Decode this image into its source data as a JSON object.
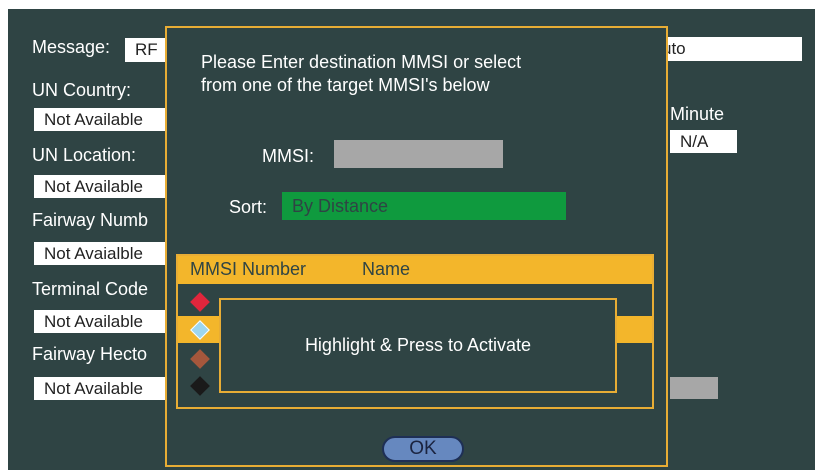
{
  "background_form": {
    "message_label": "Message:",
    "message_value": "RF",
    "message_right_value": "uto",
    "un_country_label": "UN Country:",
    "un_country_value": "Not Available",
    "minute_label": "Minute",
    "minute_value": "N/A",
    "un_location_label": "UN Location:",
    "un_location_value": "Not Available",
    "fairway_number_label": "Fairway Numb",
    "fairway_number_value": "Not Avaialble",
    "terminal_code_label": "Terminal Code",
    "terminal_code_value": "Not Available",
    "fairway_hecto_label": "Fairway Hecto",
    "fairway_hecto_value": "Not Available"
  },
  "dialog": {
    "prompt_line1": "Please Enter destination MMSI or select",
    "prompt_line2": "from one of the target MMSI's below",
    "mmsi_label": "MMSI:",
    "mmsi_value": "",
    "sort_label": "Sort:",
    "sort_value": "By Distance",
    "table_headers": [
      "MMSI Number",
      "Name"
    ],
    "rows": [
      {
        "icon": "red-diamond-icon",
        "color": "#e0263c"
      },
      {
        "icon": "light-blue-diamond-icon",
        "color": "#9dd6ef",
        "highlighted": true
      },
      {
        "icon": "brown-diamond-icon",
        "color": "#a5573c"
      },
      {
        "icon": "black-diamond-icon",
        "color": "#1a1a1a"
      }
    ],
    "hint_text": "Highlight & Press to Activate",
    "ok_label": "OK"
  },
  "colors": {
    "background": "#2f4444",
    "accent_border": "#e8ad35",
    "table_header": "#f3b62b",
    "sort_field": "#0f9a3e",
    "ok_button": "#6688bf"
  }
}
